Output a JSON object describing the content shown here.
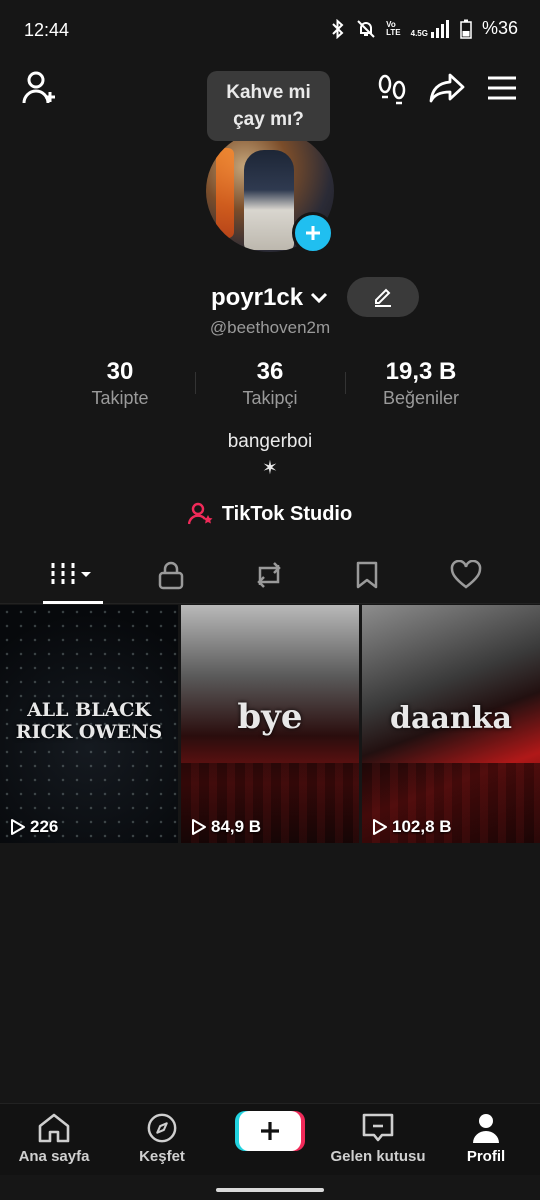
{
  "status": {
    "time": "12:44",
    "net_top": "Vo",
    "net_bottom": "LTE",
    "gen": "4.5G",
    "battery": "%36"
  },
  "bubble": {
    "line1": "Kahve mi",
    "line2": "çay mı?"
  },
  "profile": {
    "username": "poyr1ck",
    "handle": "@beethoven2m",
    "bio_line1": "bangerboi",
    "bio_line2": "✶",
    "studio_label": "TikTok Studio"
  },
  "stats": [
    {
      "value": "30",
      "label": "Takipte"
    },
    {
      "value": "36",
      "label": "Takipçi"
    },
    {
      "value": "19,3 B",
      "label": "Beğeniler"
    }
  ],
  "tabs": [
    {
      "icon": "grid-icon",
      "active": true
    },
    {
      "icon": "lock-icon",
      "active": false
    },
    {
      "icon": "repost-icon",
      "active": false
    },
    {
      "icon": "bookmark-icon",
      "active": false
    },
    {
      "icon": "heart-icon",
      "active": false
    }
  ],
  "videos": [
    {
      "overlay_line1": "ALL BLACK",
      "overlay_line2": "RICK OWENS",
      "views": "226"
    },
    {
      "overlay_line1": "bye",
      "overlay_line2": "",
      "views": "84,9 B"
    },
    {
      "overlay_line1": "daanka",
      "overlay_line2": "",
      "views": "102,8 B"
    }
  ],
  "nav": [
    {
      "label": "Ana sayfa",
      "icon": "home-icon"
    },
    {
      "label": "Keşfet",
      "icon": "compass-icon"
    },
    {
      "label": "",
      "icon": "plus-icon"
    },
    {
      "label": "Gelen kutusu",
      "icon": "inbox-icon"
    },
    {
      "label": "Profil",
      "icon": "profile-icon",
      "active": true
    }
  ],
  "colors": {
    "background": "#161616",
    "accent_blue": "#20bff0",
    "studio_pink": "#f02a59"
  }
}
